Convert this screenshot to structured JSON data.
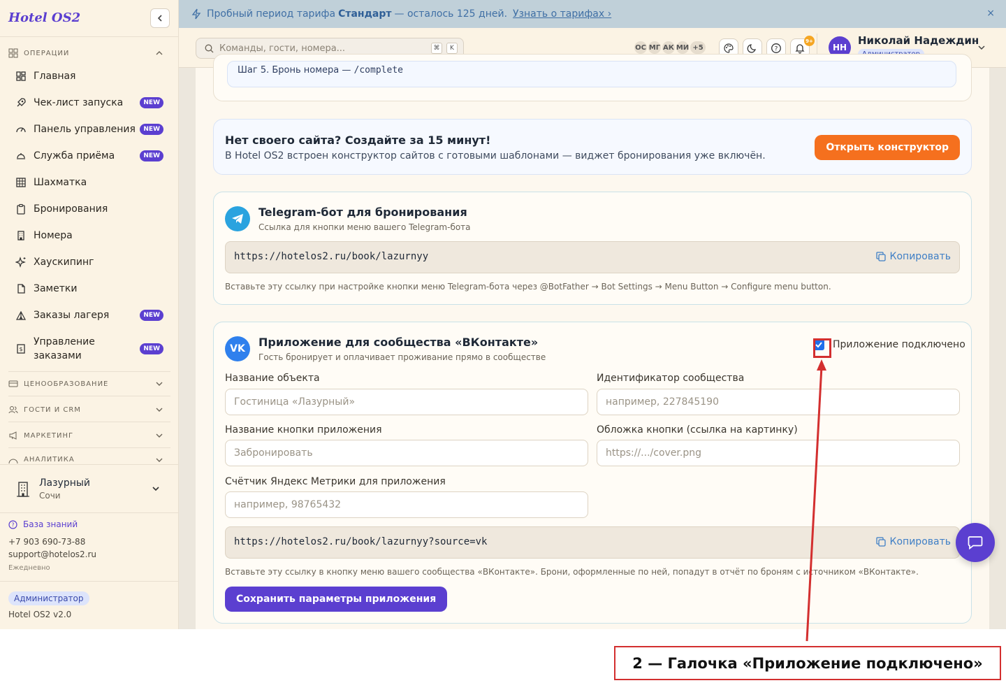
{
  "brand": "Hotel OS2",
  "sidebar": {
    "sections": [
      "Операции",
      "Ценообразование",
      "Гости и CRM",
      "Маркетинг",
      "Аналитика"
    ],
    "items": [
      {
        "label": "Главная",
        "badge": ""
      },
      {
        "label": "Чек-лист запуска",
        "badge": "NEW"
      },
      {
        "label": "Панель управления",
        "badge": "NEW"
      },
      {
        "label": "Служба приёма",
        "badge": "NEW"
      },
      {
        "label": "Шахматка",
        "badge": ""
      },
      {
        "label": "Бронирования",
        "badge": ""
      },
      {
        "label": "Номера",
        "badge": ""
      },
      {
        "label": "Хаускипинг",
        "badge": ""
      },
      {
        "label": "Заметки",
        "badge": ""
      },
      {
        "label": "Заказы лагеря",
        "badge": "NEW"
      },
      {
        "label": "Управление заказами",
        "badge": "NEW"
      }
    ],
    "hotel_name": "Лазурный",
    "hotel_city": "Сочи",
    "knowledge": "База знаний",
    "phone": "+7 903 690-73-88",
    "email": "support@hotelos2.ru",
    "schedule": "Ежедневно",
    "role": "Администратор",
    "version": "Hotel OS2 v2.0"
  },
  "banner": {
    "prefix": "Пробный период тарифа",
    "plan": "Стандарт",
    "suffix": "— осталось 125 дней.",
    "link": "Узнать о тарифах ›",
    "close": "×"
  },
  "header": {
    "search_placeholder": "Команды, гости, номера...",
    "kbd1": "⌘",
    "kbd2": "K",
    "avatars": [
      "ОС",
      "МГ",
      "АК",
      "МИ",
      "+5"
    ],
    "notif_count": "9+",
    "user_initials": "НН",
    "user_name": "Николай Надеждин",
    "user_role": "Администратор"
  },
  "main": {
    "step_prefix": "Шаг 5. Бронь номера — ",
    "step_code": "/complete",
    "promo_title": "Нет своего сайта? Создайте за 15 минут!",
    "promo_desc": "В Hotel OS2 встроен конструктор сайтов с готовыми шаблонами — виджет бронирования уже включён.",
    "promo_button": "Открыть конструктор",
    "telegram": {
      "title": "Telegram-бот для бронирования",
      "subtitle": "Ссылка для кнопки меню вашего Telegram-бота",
      "url": "https://hotelos2.ru/book/lazurnyy",
      "copy": "Копировать",
      "hint": "Вставьте эту ссылку при настройке кнопки меню Telegram-бота через @BotFather → Bot Settings → Menu Button → Configure menu button."
    },
    "vk": {
      "icon": "VK",
      "title": "Приложение для сообщества «ВКонтакте»",
      "subtitle": "Гость бронирует и оплачивает проживание прямо в сообществе",
      "connected_label": "Приложение подключено",
      "fields": {
        "object_name": {
          "label": "Название объекта",
          "placeholder": "Гостиница «Лазурный»"
        },
        "community_id": {
          "label": "Идентификатор сообщества",
          "placeholder": "например, 227845190"
        },
        "button_name": {
          "label": "Название кнопки приложения",
          "placeholder": "Забронировать"
        },
        "cover": {
          "label": "Обложка кнопки (ссылка на картинку)",
          "placeholder": "https://.../cover.png"
        },
        "metrika": {
          "label": "Счётчик Яндекс Метрики для приложения",
          "placeholder": "например, 98765432"
        }
      },
      "url": "https://hotelos2.ru/book/lazurnyy?source=vk",
      "copy": "Копировать",
      "hint": "Вставьте эту ссылку в кнопку меню вашего сообщества «ВКонтакте». Брони, оформленные по ней, попадут в отчёт по броням с источником «ВКонтакте».",
      "save_button": "Сохранить параметры приложения"
    }
  },
  "annotation": {
    "label": "2 — Галочка «Приложение подключено»",
    "color": "#d32f2f"
  }
}
